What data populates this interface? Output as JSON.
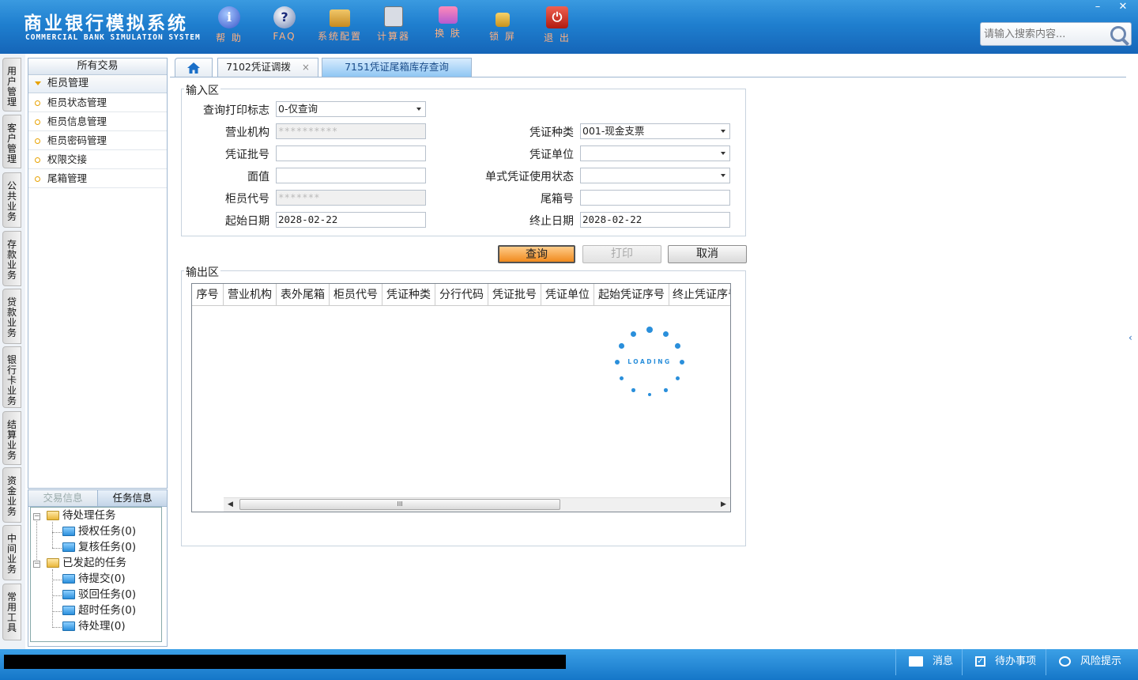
{
  "header": {
    "title_cn": "商业银行模拟系统",
    "title_en": "COMMERCIAL BANK SIMULATION SYSTEM",
    "tools": [
      {
        "label": "帮 助",
        "icon": "help-icon",
        "glyph": "i"
      },
      {
        "label": "FAQ",
        "icon": "faq-icon",
        "glyph": "?"
      },
      {
        "label": "系统配置",
        "icon": "config-icon",
        "glyph": ""
      },
      {
        "label": "计算器",
        "icon": "calculator-icon",
        "glyph": ""
      },
      {
        "label": "换 肤",
        "icon": "skin-icon",
        "glyph": ""
      },
      {
        "label": "锁 屏",
        "icon": "lock-icon",
        "glyph": ""
      },
      {
        "label": "退 出",
        "icon": "exit-icon",
        "glyph": "⏻"
      }
    ],
    "search_placeholder": "请输入搜索内容...",
    "window_minimize": "–",
    "window_close": "✕"
  },
  "vertical_tabs": [
    "用户管理",
    "客户管理",
    "公共业务",
    "存款业务",
    "贷款业务",
    "银行卡业务",
    "结算业务",
    "资金业务",
    "中间业务",
    "常用工具"
  ],
  "menu": {
    "title": "所有交易",
    "group": "柜员管理",
    "items": [
      "柜员状态管理",
      "柜员信息管理",
      "柜员密码管理",
      "权限交接",
      "尾箱管理"
    ]
  },
  "info_panel": {
    "tabs": [
      "交易信息",
      "任务信息"
    ],
    "tree": {
      "pending": {
        "label": "待处理任务",
        "children": [
          "授权任务(0)",
          "复核任务(0)"
        ]
      },
      "started": {
        "label": "已发起的任务",
        "children": [
          "待提交(0)",
          "驳回任务(0)",
          "超时任务(0)",
          "待处理(0)"
        ]
      }
    }
  },
  "tabs": {
    "home_icon": "home-icon",
    "items": [
      {
        "label": "7102凭证调拨",
        "close": "×"
      },
      {
        "label": "7151凭证尾箱库存查询"
      }
    ]
  },
  "form": {
    "input_legend": "输入区",
    "output_legend": "输出区",
    "print_flag": {
      "label": "查询打印标志",
      "value": "0-仅查询"
    },
    "org": {
      "label": "营业机构",
      "value": "**********"
    },
    "voucher_type": {
      "label": "凭证种类",
      "value": "001-现金支票"
    },
    "batch": {
      "label": "凭证批号",
      "value": ""
    },
    "unit": {
      "label": "凭证单位",
      "value": ""
    },
    "face_value": {
      "label": "面值",
      "value": ""
    },
    "status": {
      "label": "单式凭证使用状态",
      "value": ""
    },
    "teller": {
      "label": "柜员代号",
      "value": "*******"
    },
    "box_no": {
      "label": "尾箱号",
      "value": ""
    },
    "start_date": {
      "label": "起始日期",
      "value": "2028-02-22"
    },
    "end_date": {
      "label": "终止日期",
      "value": "2028-02-22"
    },
    "buttons": {
      "query": "查询",
      "print": "打印",
      "cancel": "取消"
    }
  },
  "table": {
    "columns": [
      "序号",
      "营业机构",
      "表外尾箱",
      "柜员代号",
      "凭证种类",
      "分行代码",
      "凭证批号",
      "凭证单位",
      "起始凭证序号",
      "终止凭证序号"
    ],
    "rows": [],
    "scroll_grip": "III"
  },
  "loading": {
    "text": "LOADING"
  },
  "statusbar": {
    "message": "消息",
    "todo": "待办事项",
    "risk": "风险提示"
  },
  "colors": {
    "header_blue": "#1f7fcf",
    "accent_orange": "#f08a1e",
    "loader_blue": "#2a8fdb"
  }
}
